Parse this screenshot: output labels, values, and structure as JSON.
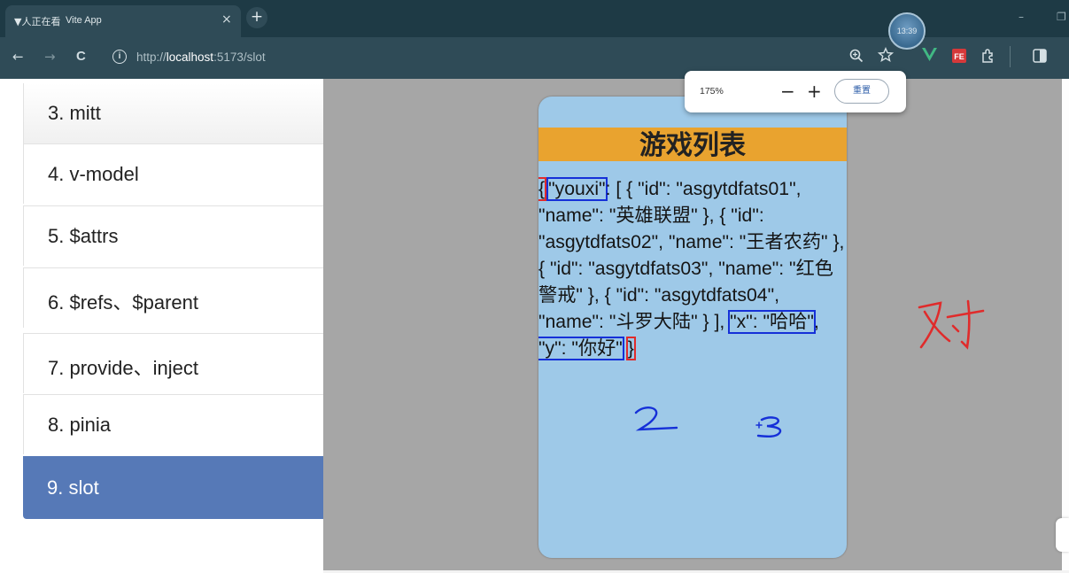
{
  "browser": {
    "tab": {
      "favicon_text": "▼人正在看",
      "title": "Vite App",
      "close_glyph": "×"
    },
    "new_tab_glyph": "+",
    "floating_avatar_time": "13:39",
    "window_controls": {
      "minimize": "–",
      "restore": "❐"
    },
    "nav": {
      "back": "←",
      "forward": "→",
      "reload": "C"
    },
    "address": {
      "info_icon": "i",
      "url_prefix": "http://",
      "url_host": "localhost",
      "url_rest": ":5173/slot"
    },
    "toolbar_icons": [
      "zoom-icon",
      "star-icon",
      "vue-devtools-icon",
      "fe-extension-icon",
      "extensions-puzzle-icon",
      "side-panel-icon"
    ]
  },
  "zoom_popup": {
    "percent": "175%",
    "minus": "−",
    "plus": "+",
    "reset_label": "重置"
  },
  "sidebar": {
    "items": [
      {
        "label": "3. mitt",
        "active": false
      },
      {
        "label": "4. v-model",
        "active": false
      },
      {
        "label": "5. $attrs",
        "active": false
      },
      {
        "label": "6. $refs、$parent",
        "active": false
      },
      {
        "label": "7. provide、inject",
        "active": false
      },
      {
        "label": "8. pinia",
        "active": false
      },
      {
        "label": "9. slot",
        "active": true
      }
    ]
  },
  "phone": {
    "header_title": "游戏列表",
    "json_text": {
      "open_brace": "{",
      "youxi_key": "\"youxi\"",
      "body": ": [ { \"id\": \"asgytdfats01\", \"name\": \"英雄联盟\" }, { \"id\": \"asgytdfats02\", \"name\": \"王者农药\" }, { \"id\": \"asgytdfats03\", \"name\": \"红色警戒\" }, { \"id\": \"asgytdfats04\", \"name\": \"斗罗大陆\" } ], ",
      "x_pair": "\"x\": \"哈哈\"",
      "comma": ", ",
      "y_pair": "\"y\": \"你好\"",
      "space": " ",
      "close_brace": "}"
    }
  },
  "annotations": {
    "number_2": "2",
    "number_3": "3",
    "check_mark_text": "对",
    "colors": {
      "red": "#e02b2b",
      "blue": "#1530d8"
    }
  }
}
